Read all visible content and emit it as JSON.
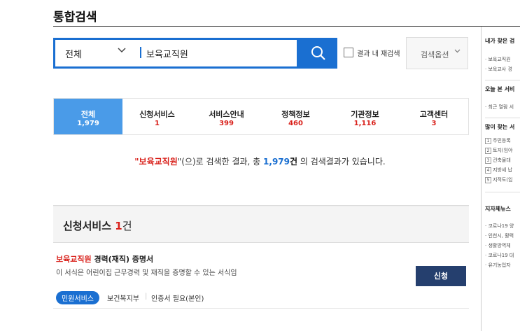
{
  "header": {
    "title": "통합검색"
  },
  "search": {
    "scope": "전체",
    "query": "보육교직원"
  },
  "recheck": {
    "label": "결과 내 재검색"
  },
  "options": {
    "label": "검색옵션"
  },
  "tabs": [
    {
      "label": "전체",
      "count": "1,979"
    },
    {
      "label": "신청서비스",
      "count": "1"
    },
    {
      "label": "서비스안내",
      "count": "399"
    },
    {
      "label": "정책정보",
      "count": "460"
    },
    {
      "label": "기관정보",
      "count": "1,116"
    },
    {
      "label": "고객센터",
      "count": "3"
    }
  ],
  "summary": {
    "q_open": "\"",
    "keyword": "보육교직원",
    "q_close": "\"(으)로 검색한 결과, 총 ",
    "total": "1,979",
    "unit": "건",
    "tail": " 의 검색결과가 있습니다."
  },
  "section": {
    "title": "신청서비스",
    "count": "1",
    "unit": "건"
  },
  "result": {
    "title_highlight": "보육교직원",
    "title_rest": " 경력(재직) 증명서",
    "desc": "이 서식은 어린이집 근무경력 및 재직을 증명할 수 있는 서식임",
    "apply_label": "신청",
    "badge": "민원서비스",
    "dept": "보건복지부",
    "auth": "인증서 필요(본인)"
  },
  "sidebar": {
    "recent_search": {
      "title": "내가 찾은 검",
      "items": [
        "보육교직원",
        "보육교사 경"
      ]
    },
    "today_viewed": {
      "title": "오늘 본 서비",
      "items": [
        "최근 열람 서"
      ]
    },
    "popular": {
      "title": "많이 찾는 서",
      "items": [
        "주민등록",
        "토지(임야",
        "건축물대",
        "지방세 납",
        "지적도(임"
      ]
    },
    "news": {
      "title": "지자체뉴스",
      "items": [
        "코로나19 양",
        "인천시, 활력",
        "생활방역체",
        "코로나19 대",
        "유기농업자"
      ]
    }
  }
}
